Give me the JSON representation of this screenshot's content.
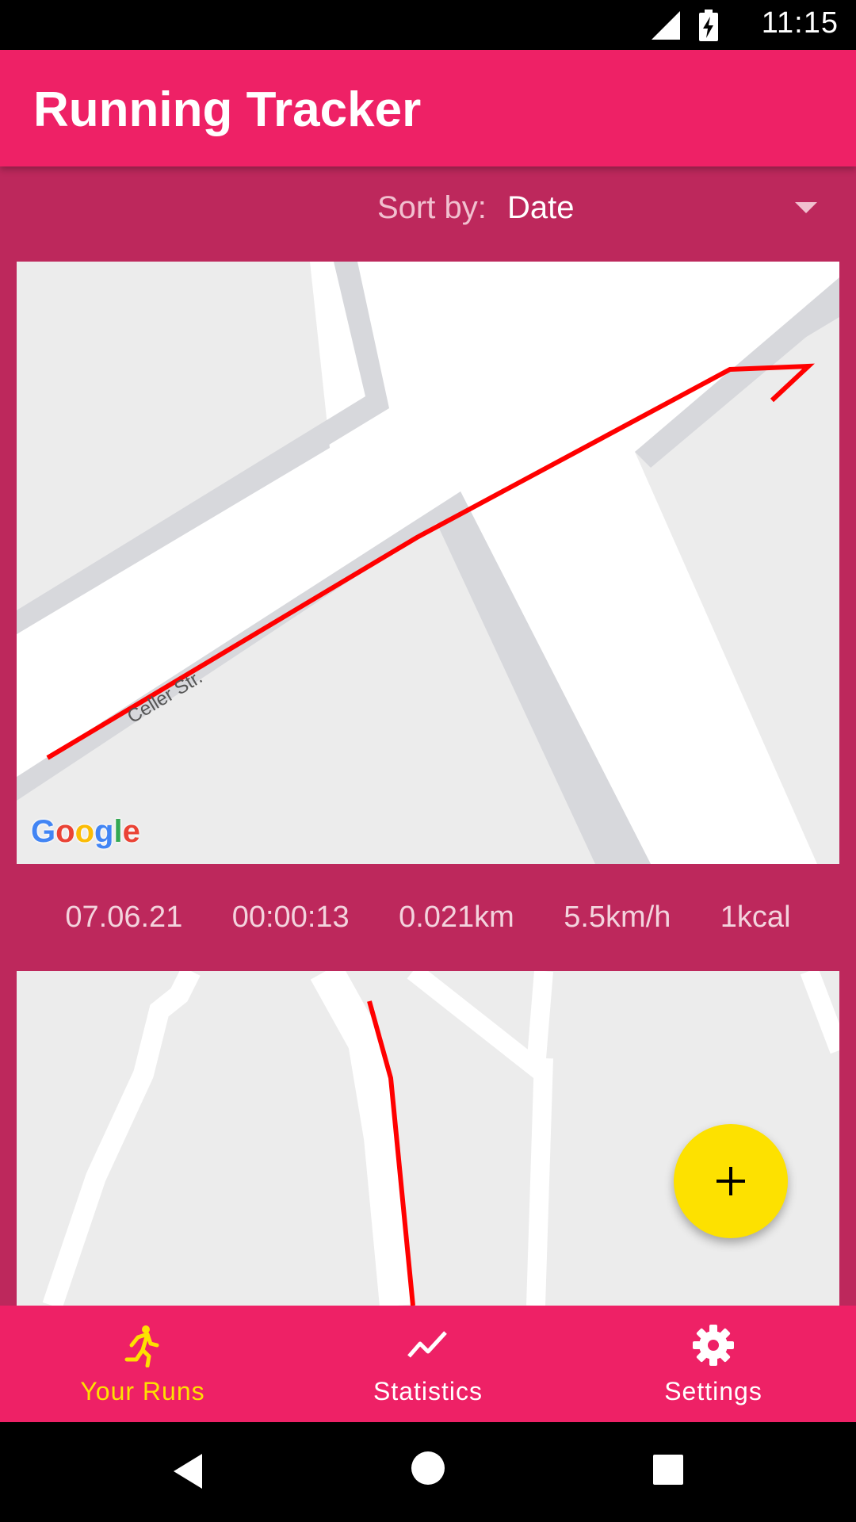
{
  "status_bar": {
    "time": "11:15",
    "icons": [
      "signal-icon",
      "battery-charging-icon"
    ]
  },
  "app_bar": {
    "title": "Running Tracker"
  },
  "sort": {
    "label": "Sort by:",
    "value": "Date"
  },
  "runs": [
    {
      "street": "Celler Str.",
      "map_attribution": "Google",
      "date": "07.06.21",
      "duration": "00:00:13",
      "distance": "0.021km",
      "speed": "5.5km/h",
      "calories": "1kcal"
    },
    {}
  ],
  "fab": {
    "icon": "plus-icon"
  },
  "bottom_nav": {
    "items": [
      {
        "label": "Your Runs",
        "icon": "running-icon",
        "active": true
      },
      {
        "label": "Statistics",
        "icon": "chart-line-icon",
        "active": false
      },
      {
        "label": "Settings",
        "icon": "gear-icon",
        "active": false
      }
    ]
  },
  "system_nav": [
    "back-icon",
    "home-icon",
    "recents-icon"
  ],
  "colors": {
    "primary": "#ee2166",
    "background": "#bd285c",
    "accent": "#fde100",
    "route": "#ff0000"
  }
}
